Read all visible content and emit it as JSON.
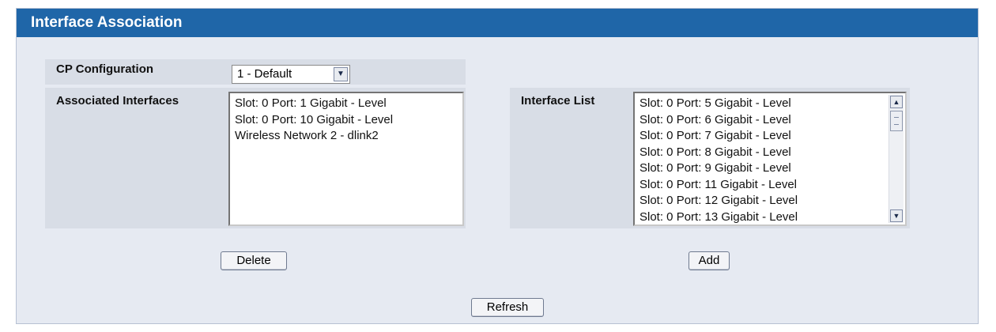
{
  "panel": {
    "title": "Interface Association"
  },
  "cp_configuration": {
    "label": "CP Configuration",
    "selected": "1 - Default"
  },
  "associated_interfaces": {
    "label": "Associated Interfaces",
    "items": [
      "Slot: 0 Port: 1 Gigabit - Level",
      "Slot: 0 Port: 10 Gigabit - Level",
      "Wireless Network 2 - dlink2"
    ]
  },
  "interface_list": {
    "label": "Interface List",
    "items": [
      "Slot: 0 Port: 5 Gigabit - Level",
      "Slot: 0 Port: 6 Gigabit - Level",
      "Slot: 0 Port: 7 Gigabit - Level",
      "Slot: 0 Port: 8 Gigabit - Level",
      "Slot: 0 Port: 9 Gigabit - Level",
      "Slot: 0 Port: 11 Gigabit - Level",
      "Slot: 0 Port: 12 Gigabit - Level",
      "Slot: 0 Port: 13 Gigabit - Level"
    ]
  },
  "buttons": {
    "delete": "Delete",
    "add": "Add",
    "refresh": "Refresh"
  },
  "icons": {
    "dropdown": "chevron-down-icon",
    "scroll_up": "chevron-up-icon",
    "scroll_down": "chevron-down-icon"
  },
  "colors": {
    "header": "#1f66a8",
    "panel": "#e6eaf2",
    "cell": "#d8dde6"
  }
}
